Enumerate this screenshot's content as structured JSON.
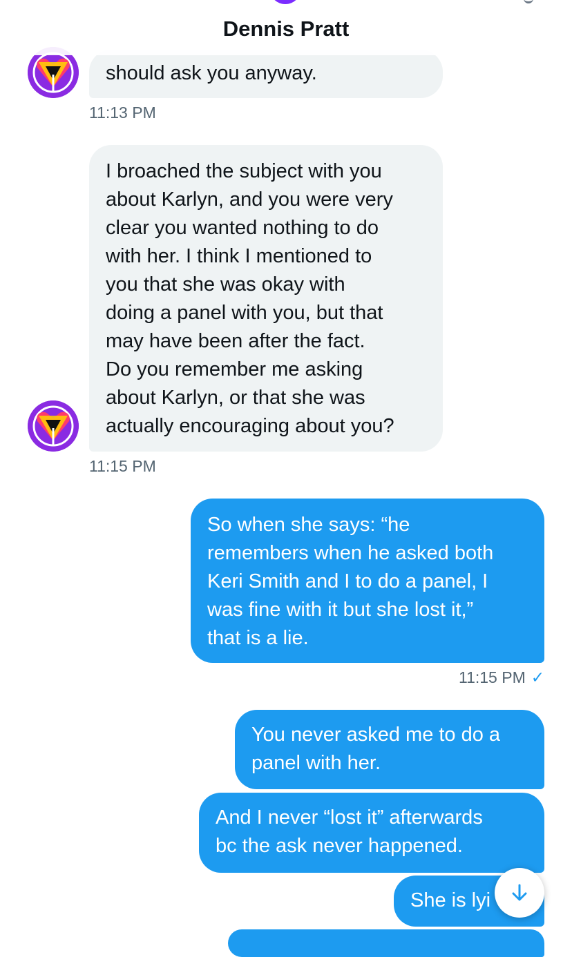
{
  "header": {
    "title": "Dennis Pratt"
  },
  "messages": [
    {
      "direction": "in",
      "lines": [
        "should ask you anyway."
      ],
      "timestamp": "11:13 PM"
    },
    {
      "direction": "in",
      "lines": [
        "I broached the subject with you",
        "about Karlyn, and you were very",
        "clear you wanted nothing to do",
        "with her.  I think I mentioned to",
        "you that she was okay with",
        "doing a panel with you, but that",
        "may have been after the fact.",
        "Do you remember me asking",
        "about Karlyn, or that she was",
        "actually encouraging about you?"
      ],
      "timestamp": "11:15 PM"
    },
    {
      "direction": "out",
      "lines": [
        "So when she says: “he",
        "remembers when he asked both",
        "Keri Smith and I to do a panel, I",
        "was fine with it but she lost it,”",
        "that is a lie."
      ],
      "timestamp": "11:15 PM",
      "read_mark": "✓"
    },
    {
      "direction": "out",
      "lines": [
        "You never asked me to do a",
        "panel with her."
      ]
    },
    {
      "direction": "out",
      "lines": [
        "And I never “lost it” afterwards",
        "bc the ask never happened."
      ]
    },
    {
      "direction": "out",
      "lines": [
        "She is lyi"
      ]
    }
  ],
  "colors": {
    "outgoing": "#1d9bf0",
    "incoming": "#eff3f4",
    "timestamp": "#536471"
  },
  "icons": {
    "avatar": "heart-triangle-avatar-icon",
    "scroll": "arrow-down-icon"
  }
}
